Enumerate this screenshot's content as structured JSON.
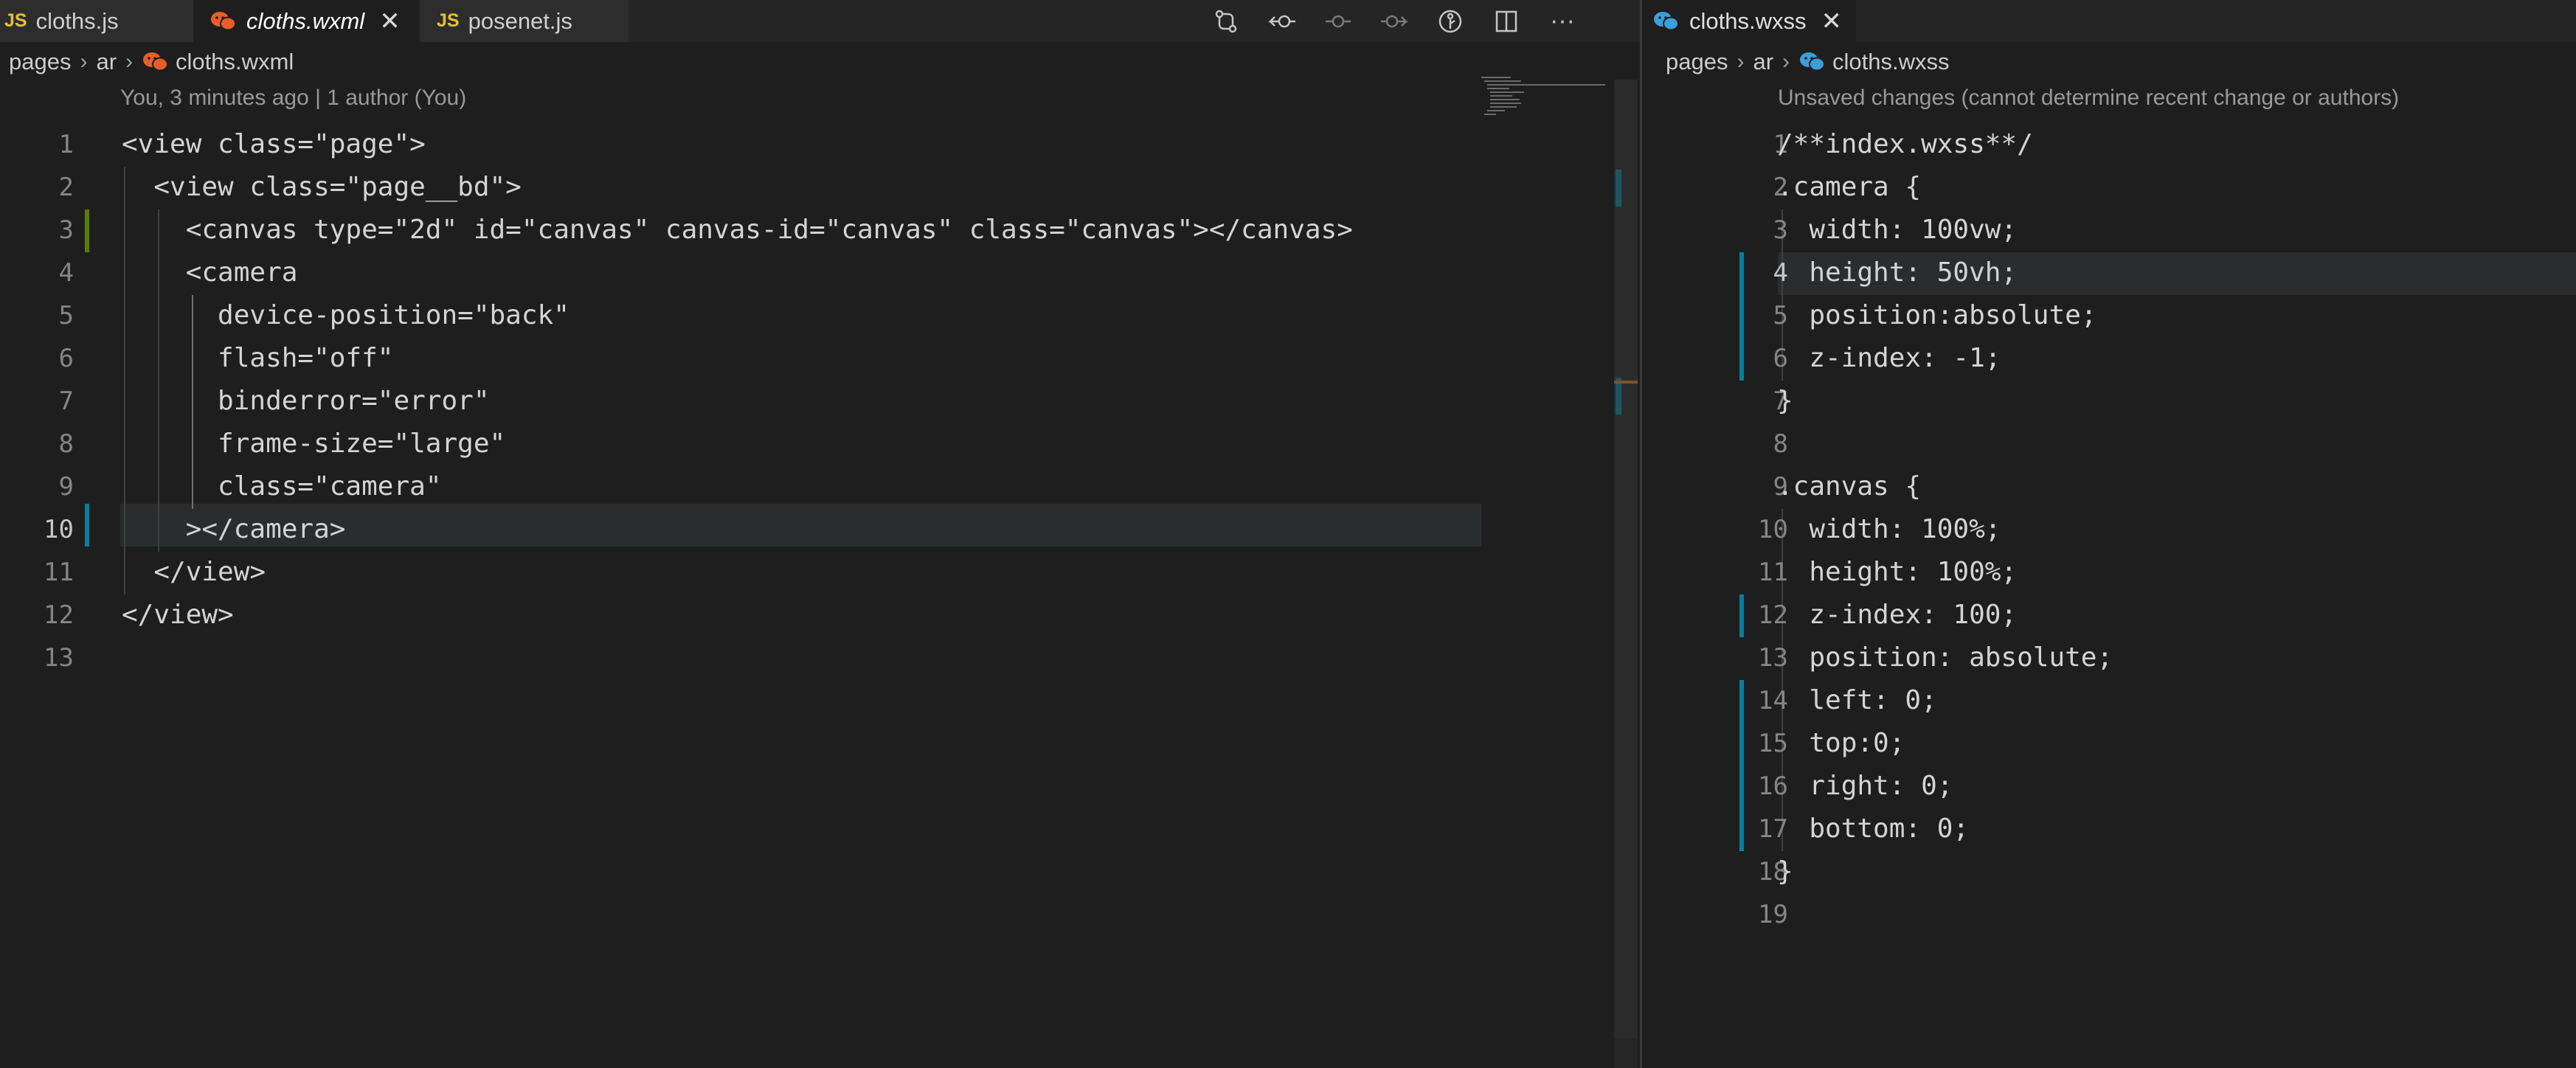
{
  "left": {
    "tabs": [
      {
        "badge": "JS",
        "label": "cloths.js"
      },
      {
        "label": "cloths.wxml",
        "close": "✕"
      },
      {
        "badge": "JS",
        "label": "posenet.js"
      }
    ],
    "toolbar_icons": [
      "git-compare-icon",
      "go-back-change-icon",
      "git-commit-icon",
      "go-forward-change-icon",
      "git-lens-icon",
      "split-editor-icon",
      "more-actions-icon"
    ],
    "toolbar_more": "···",
    "breadcrumb": [
      "pages",
      "ar",
      "cloths.wxml"
    ],
    "codelens": "You, 3 minutes ago | 1 author (You)",
    "lines": [
      "<view class=\"page\">",
      "  <view class=\"page__bd\">",
      "    <canvas type=\"2d\" id=\"canvas\" canvas-id=\"canvas\" class=\"canvas\"></canvas>",
      "    <camera",
      "      device-position=\"back\"",
      "      flash=\"off\"",
      "      binderror=\"error\"",
      "      frame-size=\"large\"",
      "      class=\"camera\"",
      "    ></camera>",
      "  </view>",
      "</view>",
      ""
    ],
    "line_numbers": [
      "1",
      "2",
      "3",
      "4",
      "5",
      "6",
      "7",
      "8",
      "9",
      "10",
      "11",
      "12",
      "13"
    ]
  },
  "right": {
    "tab": {
      "label": "cloths.wxss",
      "close": "✕"
    },
    "breadcrumb": [
      "pages",
      "ar",
      "cloths.wxss"
    ],
    "codelens": "Unsaved changes (cannot determine recent change or authors)",
    "lines": [
      "/**index.wxss**/",
      ".camera {",
      "  width: 100vw;",
      "  height: 50vh;",
      "  position:absolute;",
      "  z-index: -1;",
      "}",
      "",
      ".canvas {",
      "  width: 100%;",
      "  height: 100%;",
      "  z-index: 100;",
      "  position: absolute;",
      "  left: 0;",
      "  top:0;",
      "  right: 0;",
      "  bottom: 0;",
      "}",
      ""
    ],
    "line_numbers": [
      "1",
      "2",
      "3",
      "4",
      "5",
      "6",
      "7",
      "8",
      "9",
      "10",
      "11",
      "12",
      "13",
      "14",
      "15",
      "16",
      "17",
      "18",
      "19"
    ]
  },
  "colors": {
    "background": "#1e1e1e",
    "tabbar": "#252526",
    "modified_gutter": "#0c7d9d",
    "added_gutter": "#587c0c",
    "js_badge": "#e5c232",
    "wxml_icon": "#e65f2b",
    "wxss_icon": "#3c9fd8"
  }
}
